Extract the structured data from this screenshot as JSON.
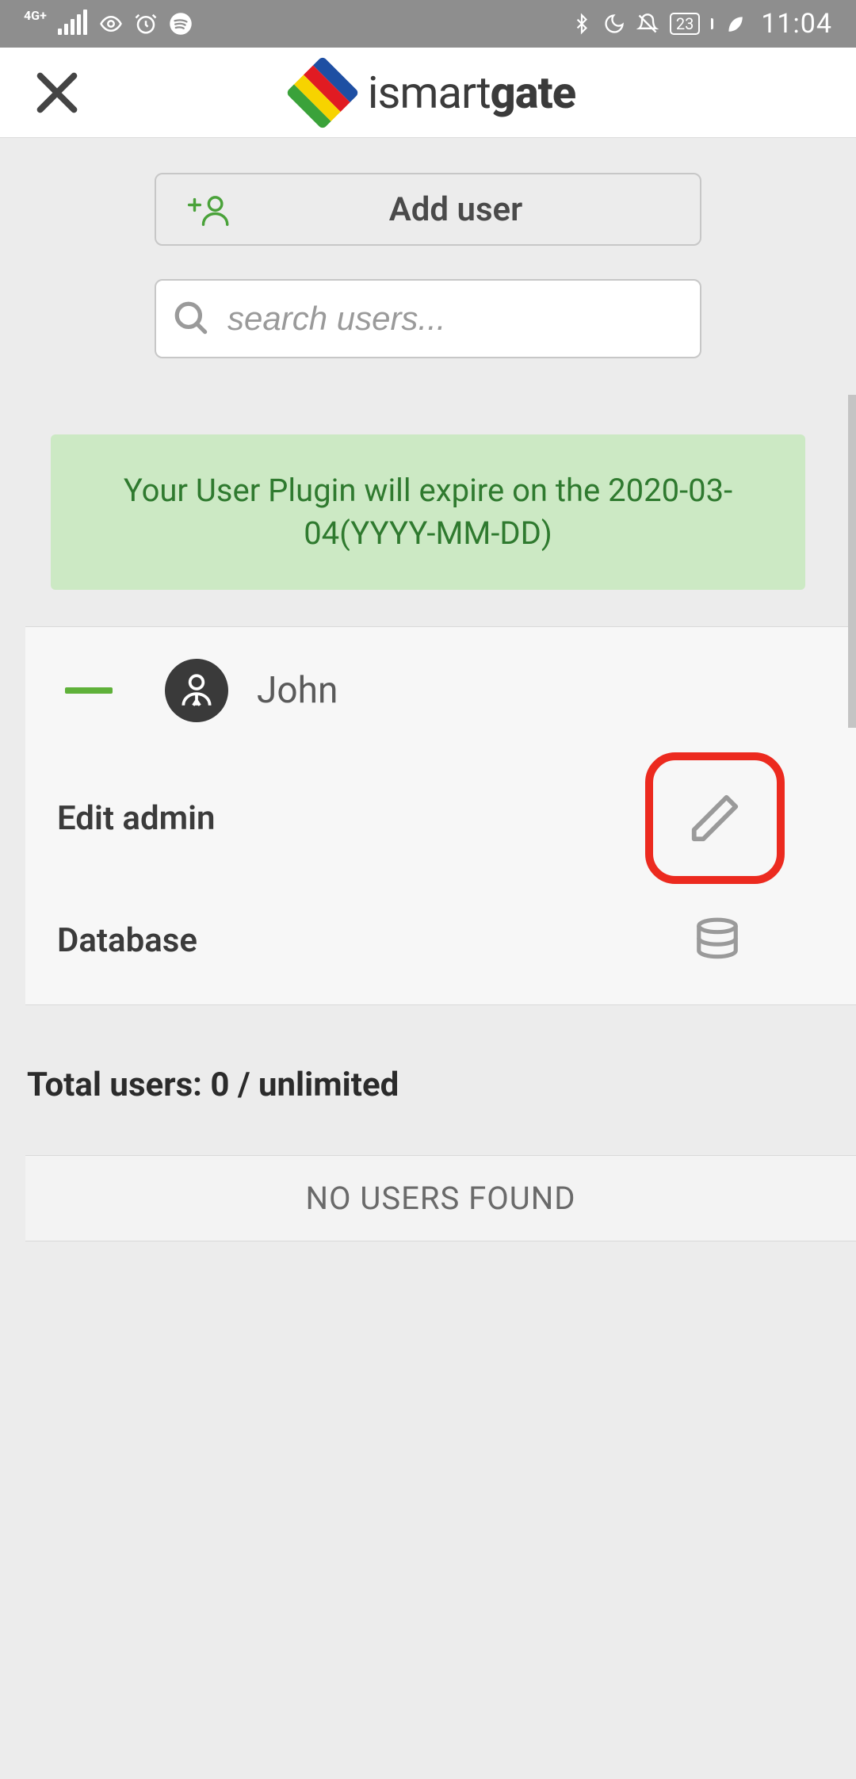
{
  "statusbar": {
    "network": "4G+",
    "battery": "23",
    "time": "11:04"
  },
  "header": {
    "brand_light": "ismart",
    "brand_bold": "gate"
  },
  "actions": {
    "add_user": "Add user"
  },
  "search": {
    "placeholder": "search users..."
  },
  "notice": {
    "text": "Your User Plugin will expire on the 2020-03-04(YYYY-MM-DD)"
  },
  "admin_card": {
    "name": "John",
    "edit_label": "Edit admin",
    "db_label": "Database"
  },
  "totals": {
    "text": "Total users: 0 / unlimited"
  },
  "empty_state": {
    "text": "NO USERS FOUND"
  }
}
